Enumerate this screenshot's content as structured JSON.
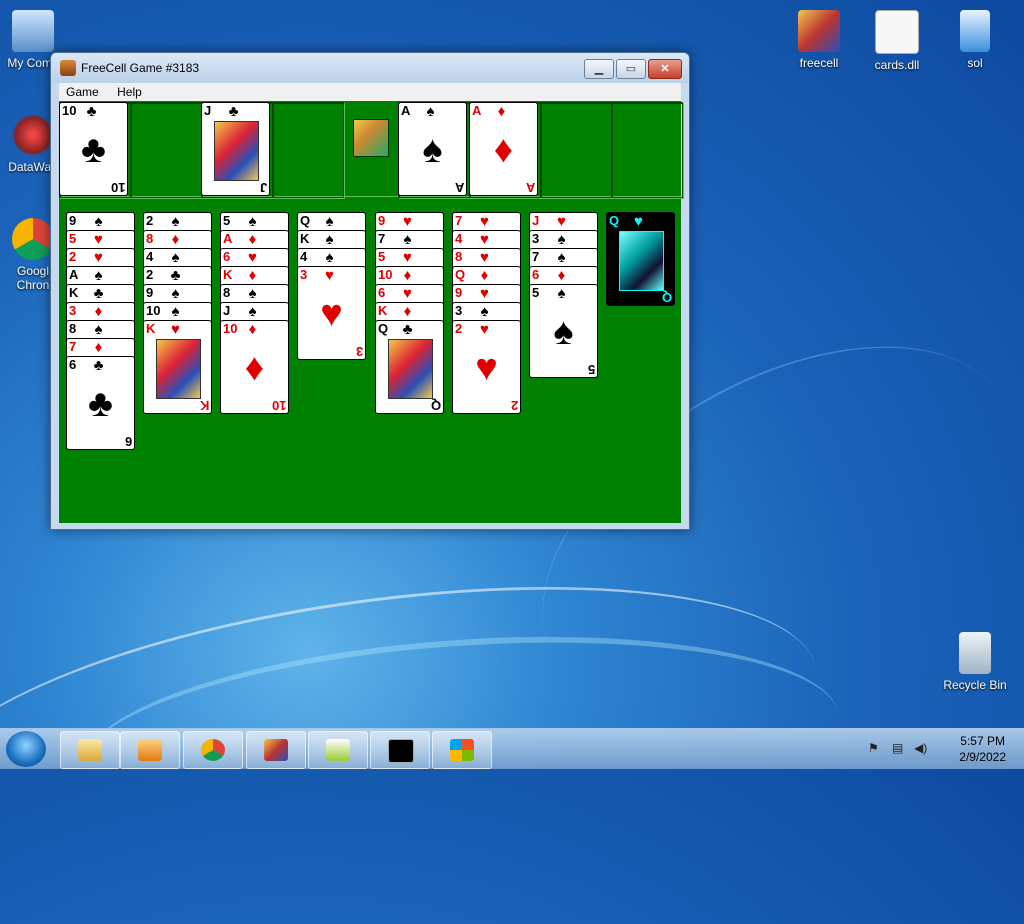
{
  "desktop": {
    "icons": {
      "my_computer": "My Comp",
      "datawag": "DataWag",
      "chrome_a": "Googl",
      "chrome_b": "Chron",
      "freecell": "freecell",
      "cards": "cards.dll",
      "sol": "sol",
      "recycle": "Recycle Bin"
    }
  },
  "window": {
    "title": "FreeCell Game #3183",
    "menu": {
      "game": "Game",
      "help": "Help"
    },
    "controls": {
      "minimize": "▁",
      "maximize": "▭",
      "close": "✕"
    }
  },
  "freecells": [
    {
      "rank": "10",
      "suit": "♣",
      "color": "black"
    },
    null,
    {
      "rank": "J",
      "suit": "♣",
      "color": "black"
    },
    null
  ],
  "foundations": [
    {
      "rank": "A",
      "suit": "♠",
      "color": "black"
    },
    {
      "rank": "A",
      "suit": "♦",
      "color": "red"
    },
    null,
    null
  ],
  "indicator_arrow": "↑",
  "columns": [
    [
      [
        "9",
        "♠",
        "black"
      ],
      [
        "5",
        "♥",
        "red"
      ],
      [
        "2",
        "♥",
        "red"
      ],
      [
        "A",
        "♠",
        "black"
      ],
      [
        "K",
        "♣",
        "black"
      ],
      [
        "3",
        "♦",
        "red"
      ],
      [
        "8",
        "♠",
        "black"
      ],
      [
        "7",
        "♦",
        "red"
      ],
      [
        "6",
        "♣",
        "black"
      ]
    ],
    [
      [
        "2",
        "♠",
        "black"
      ],
      [
        "8",
        "♦",
        "red"
      ],
      [
        "4",
        "♠",
        "black"
      ],
      [
        "2",
        "♣",
        "black"
      ],
      [
        "9",
        "♠",
        "black"
      ],
      [
        "10",
        "♠",
        "black"
      ],
      [
        "K",
        "♥",
        "red"
      ]
    ],
    [
      [
        "5",
        "♠",
        "black"
      ],
      [
        "A",
        "♦",
        "red"
      ],
      [
        "6",
        "♥",
        "red"
      ],
      [
        "K",
        "♦",
        "red"
      ],
      [
        "8",
        "♠",
        "black"
      ],
      [
        "J",
        "♠",
        "black"
      ],
      [
        "10",
        "♦",
        "red"
      ]
    ],
    [
      [
        "Q",
        "♠",
        "black"
      ],
      [
        "K",
        "♠",
        "black"
      ],
      [
        "4",
        "♠",
        "black"
      ],
      [
        "3",
        "♥",
        "red"
      ]
    ],
    [
      [
        "9",
        "♥",
        "red"
      ],
      [
        "7",
        "♠",
        "black"
      ],
      [
        "5",
        "♥",
        "red"
      ],
      [
        "10",
        "♦",
        "red"
      ],
      [
        "6",
        "♥",
        "red"
      ],
      [
        "K",
        "♦",
        "red"
      ],
      [
        "Q",
        "♣",
        "black"
      ]
    ],
    [
      [
        "7",
        "♥",
        "red"
      ],
      [
        "4",
        "♥",
        "red"
      ],
      [
        "8",
        "♥",
        "red"
      ],
      [
        "Q",
        "♦",
        "red"
      ],
      [
        "9",
        "♥",
        "red"
      ],
      [
        "3",
        "♠",
        "black"
      ],
      [
        "2",
        "♥",
        "red"
      ]
    ],
    [
      [
        "J",
        "♥",
        "red"
      ],
      [
        "3",
        "♠",
        "black"
      ],
      [
        "7",
        "♠",
        "black"
      ],
      [
        "6",
        "♦",
        "red"
      ],
      [
        "5",
        "♠",
        "black"
      ]
    ],
    [
      [
        "Q",
        "♥",
        "red"
      ]
    ]
  ],
  "highlighted": {
    "column": 7,
    "card": 0
  },
  "taskbar": {
    "time": "5:57 PM",
    "date": "2/9/2022"
  }
}
